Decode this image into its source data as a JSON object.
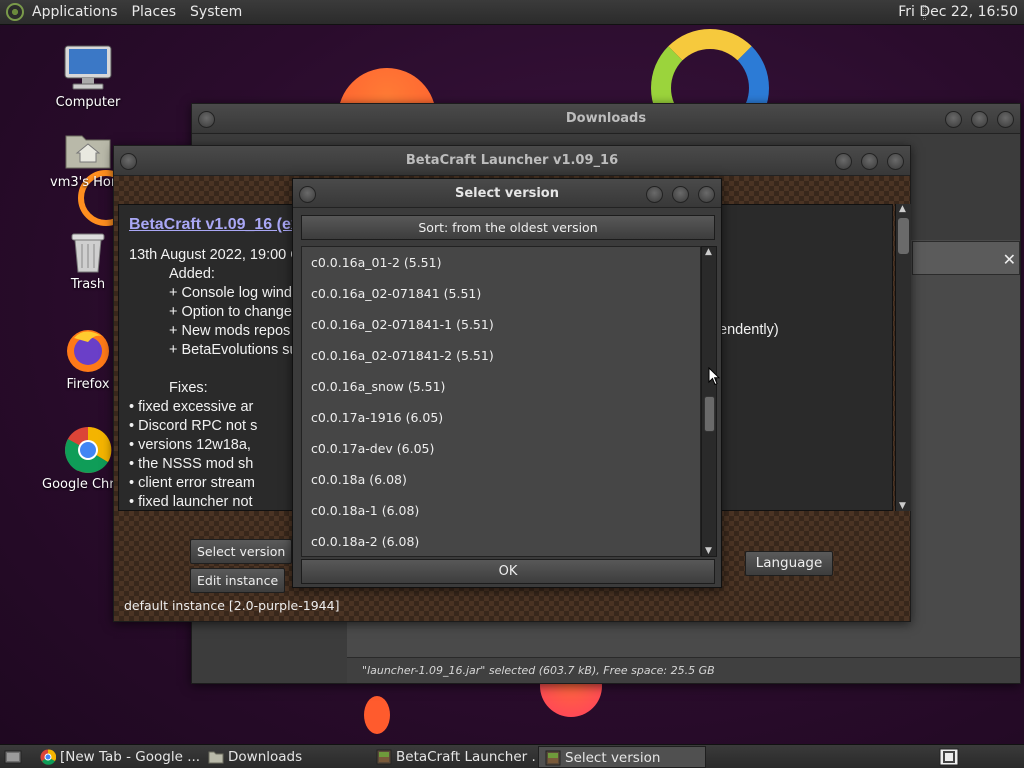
{
  "top_panel": {
    "menus": [
      "Applications",
      "Places",
      "System"
    ],
    "clock": "Fri Dec 22, 16:50"
  },
  "desktop_icons": [
    {
      "label": "Computer",
      "icon": "computer-icon"
    },
    {
      "label": "vm3's Home",
      "icon": "home-folder-icon"
    },
    {
      "label": "Trash",
      "icon": "trash-icon"
    },
    {
      "label": "Firefox",
      "icon": "firefox-icon"
    },
    {
      "label": "Google Chrome",
      "icon": "chrome-icon"
    }
  ],
  "downloads_window": {
    "title": "Downloads",
    "status": "\"launcher-1.09_16.jar\" selected (603.7 kB), Free space: 25.5 GB"
  },
  "launcher_window": {
    "title": "BetaCraft Launcher v1.09_16",
    "changelog": {
      "title": "BetaCraft v1.09_16 (ex",
      "date": "13th August 2022, 19:00 C",
      "added_header": "Added:",
      "added": [
        "+ Console log windo",
        "+ Option to change",
        "+ New mods repos",
        "+ BetaEvolutions su"
      ],
      "added_trailing": "endently)",
      "fixes_header": "Fixes:",
      "fixes": [
        "• fixed excessive ar",
        "• Discord RPC not s",
        "• versions 12w18a,",
        "• the NSSS mod sh",
        "• client error stream",
        "• fixed launcher not"
      ]
    },
    "buttons": {
      "select_version": "Select version",
      "edit_instance": "Edit instance",
      "language": "Language"
    },
    "instance_label": "default instance [2.0-purple-1944]"
  },
  "select_version_dialog": {
    "title": "Select version",
    "sort_label": "Sort: from the oldest version",
    "versions": [
      "c0.0.16a_01-2 (5.51)",
      "c0.0.16a_02-071841 (5.51)",
      "c0.0.16a_02-071841-1 (5.51)",
      "c0.0.16a_02-071841-2 (5.51)",
      "c0.0.16a_snow (5.51)",
      "c0.0.17a-1916 (6.05)",
      "c0.0.17a-dev (6.05)",
      "c0.0.18a (6.08)",
      "c0.0.18a-1 (6.08)",
      "c0.0.18a-2 (6.08)"
    ],
    "ok_label": "OK"
  },
  "taskbar": {
    "tasks": [
      {
        "label": "[New Tab - Google ...",
        "icon": "chrome-icon",
        "active": false
      },
      {
        "label": "Downloads",
        "icon": "folder-icon",
        "active": false
      },
      {
        "label": "BetaCraft Launcher ...",
        "icon": "java-icon",
        "active": false
      },
      {
        "label": "Select version",
        "icon": "java-icon",
        "active": true
      }
    ]
  }
}
